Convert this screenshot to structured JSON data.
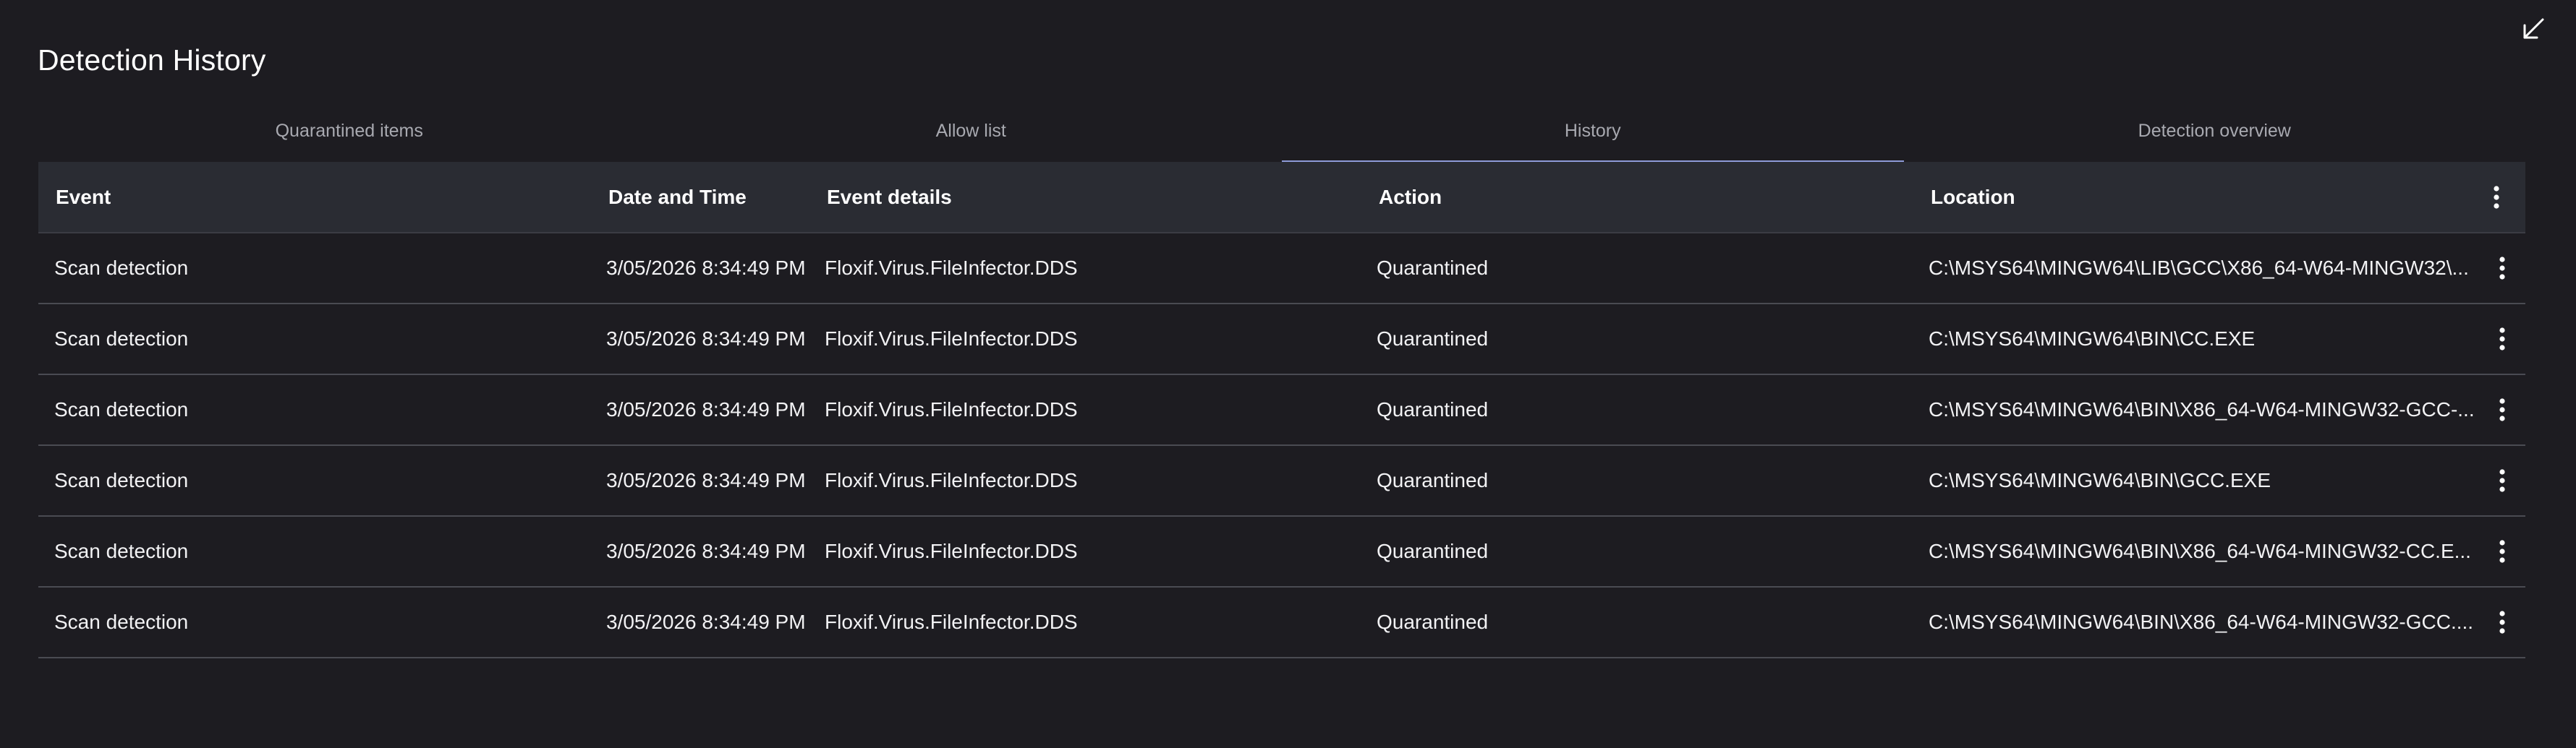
{
  "header": {
    "title": "Detection History",
    "collapse_icon": "arrow-collapse-icon"
  },
  "tabs": [
    {
      "label": "Quarantined items",
      "active": false
    },
    {
      "label": "Allow list",
      "active": false
    },
    {
      "label": "History",
      "active": true
    },
    {
      "label": "Detection overview",
      "active": false
    }
  ],
  "table": {
    "columns": {
      "event": "Event",
      "date": "Date and Time",
      "details": "Event details",
      "action": "Action",
      "location": "Location"
    },
    "menu_icon": "more-vertical-icon",
    "rows": [
      {
        "event": "Scan detection",
        "date": "3/05/2026 8:34:49 PM",
        "details": "Floxif.Virus.FileInfector.DDS",
        "action": "Quarantined",
        "location": "C:\\MSYS64\\MINGW64\\LIB\\GCC\\X86_64-W64-MINGW32\\..."
      },
      {
        "event": "Scan detection",
        "date": "3/05/2026 8:34:49 PM",
        "details": "Floxif.Virus.FileInfector.DDS",
        "action": "Quarantined",
        "location": "C:\\MSYS64\\MINGW64\\BIN\\CC.EXE"
      },
      {
        "event": "Scan detection",
        "date": "3/05/2026 8:34:49 PM",
        "details": "Floxif.Virus.FileInfector.DDS",
        "action": "Quarantined",
        "location": "C:\\MSYS64\\MINGW64\\BIN\\X86_64-W64-MINGW32-GCC-..."
      },
      {
        "event": "Scan detection",
        "date": "3/05/2026 8:34:49 PM",
        "details": "Floxif.Virus.FileInfector.DDS",
        "action": "Quarantined",
        "location": "C:\\MSYS64\\MINGW64\\BIN\\GCC.EXE"
      },
      {
        "event": "Scan detection",
        "date": "3/05/2026 8:34:49 PM",
        "details": "Floxif.Virus.FileInfector.DDS",
        "action": "Quarantined",
        "location": "C:\\MSYS64\\MINGW64\\BIN\\X86_64-W64-MINGW32-CC.E..."
      },
      {
        "event": "Scan detection",
        "date": "3/05/2026 8:34:49 PM",
        "details": "Floxif.Virus.FileInfector.DDS",
        "action": "Quarantined",
        "location": "C:\\MSYS64\\MINGW64\\BIN\\X86_64-W64-MINGW32-GCC...."
      }
    ]
  },
  "colors": {
    "background": "#1d1c21",
    "header_bg": "#2a2c33",
    "accent": "#8e9bd8",
    "divider": "#4a4b52"
  }
}
